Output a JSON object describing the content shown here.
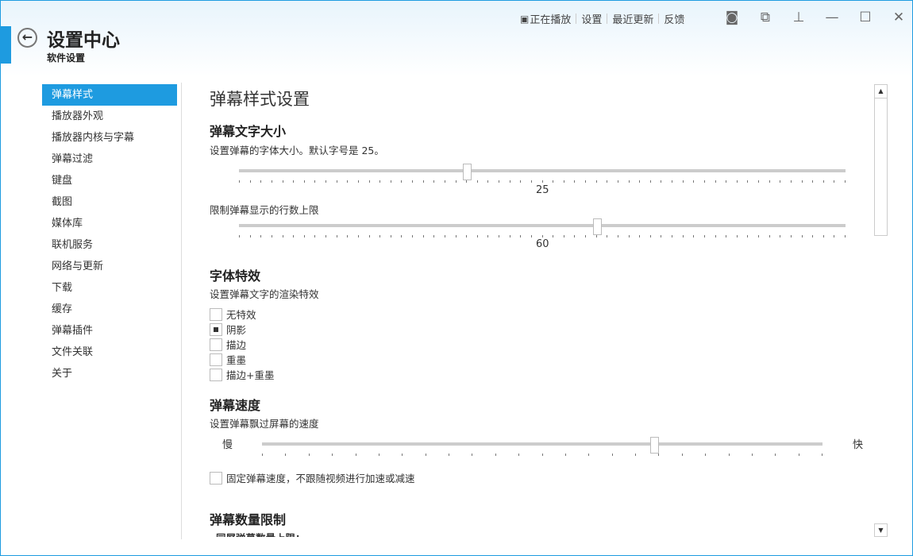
{
  "header": {
    "title": "设置中心",
    "subtitle": "软件设置",
    "nav": [
      "正在播放",
      "设置",
      "最近更新",
      "反馈"
    ],
    "window_icons": [
      "camera-icon",
      "mini-mode-icon",
      "pin-icon",
      "minimize-icon",
      "maximize-icon",
      "close-icon"
    ]
  },
  "sidebar": {
    "items": [
      "弹幕样式",
      "播放器外观",
      "播放器内核与字幕",
      "弹幕过滤",
      "键盘",
      "截图",
      "媒体库",
      "联机服务",
      "网络与更新",
      "下载",
      "缓存",
      "弹幕插件",
      "文件关联",
      "关于"
    ],
    "active": 0
  },
  "main": {
    "title": "弹幕样式设置",
    "font_size": {
      "heading": "弹幕文字大小",
      "desc": "设置弹幕的字体大小。默认字号是 25。",
      "value": "25",
      "position_pct": 37.5
    },
    "rows": {
      "label": "限制弹幕显示的行数上限",
      "value": "60",
      "position_pct": 59
    },
    "effects": {
      "heading": "字体特效",
      "desc": "设置弹幕文字的渲染特效",
      "options": [
        {
          "label": "无特效",
          "checked": false
        },
        {
          "label": "阴影",
          "checked": true
        },
        {
          "label": "描边",
          "checked": false
        },
        {
          "label": "重墨",
          "checked": false
        },
        {
          "label": "描边+重墨",
          "checked": false
        }
      ]
    },
    "speed": {
      "heading": "弹幕速度",
      "desc": "设置弹幕飘过屏幕的速度",
      "slow": "慢",
      "fast": "快",
      "position_pct": 70,
      "fixed_label": "固定弹幕速度，不跟随视频进行加速或减速",
      "fixed_checked": false
    },
    "count": {
      "heading": "弹幕数量限制",
      "label": "同屏弹幕数量上限："
    }
  },
  "colors": {
    "accent": "#1e9be0"
  }
}
